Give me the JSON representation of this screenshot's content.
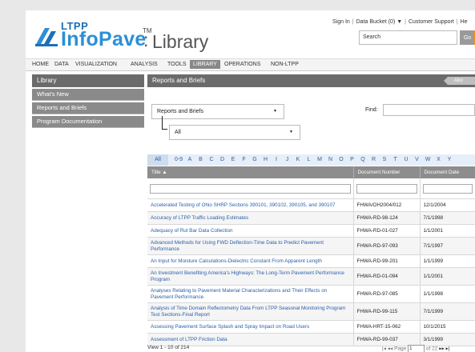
{
  "logo": {
    "ltpp": "LTPP",
    "name": "InfoPave",
    "tm": "TM",
    "separator": ":",
    "section": "Library"
  },
  "toplinks": [
    "Sign In",
    "Data Bucket (0) ▼",
    "Customer Support",
    "He"
  ],
  "search": {
    "placeholder": "Search",
    "go_label": "Go"
  },
  "nav": [
    {
      "label": "HOME",
      "active": false
    },
    {
      "label": "DATA",
      "active": false
    },
    {
      "label": "VISUALIZATION",
      "active": false
    },
    {
      "label": "ANALYSIS",
      "active": false
    },
    {
      "label": "TOOLS",
      "active": false
    },
    {
      "label": "LIBRARY",
      "active": true
    },
    {
      "label": "OPERATIONS",
      "active": false
    },
    {
      "label": "NON-LTPP",
      "active": false
    }
  ],
  "sidebar": {
    "title": "Library",
    "items": [
      "What's New",
      "Reports and Briefs",
      "Program Documentation"
    ]
  },
  "main": {
    "title": "Reports and Briefs",
    "about_label": "Abo",
    "category_select": "Reports and Briefs",
    "sub_select": "All",
    "find_label": "Find:"
  },
  "alphabet": [
    "All",
    "0-9",
    "A",
    "B",
    "C",
    "D",
    "E",
    "F",
    "G",
    "H",
    "I",
    "J",
    "K",
    "L",
    "M",
    "N",
    "O",
    "P",
    "Q",
    "R",
    "S",
    "T",
    "U",
    "V",
    "W",
    "X",
    "Y"
  ],
  "table": {
    "headers": {
      "title": "Title",
      "number": "Document Number",
      "date": "Document Date"
    },
    "sort_icon": "sort-up-icon",
    "rows": [
      {
        "title": "Accelerated Testing of Ohio SHRP Sections 390101, 390102, 390105, and 390107",
        "number": "FHWA/OH2004/012",
        "date": "12/1/2004"
      },
      {
        "title": "Accuracy of LTPP Traffic Loading Estimates",
        "number": "FHWA-RD-98-124",
        "date": "7/1/1998"
      },
      {
        "title": "Adequacy of Rut Bar Data Collection",
        "number": "FHWA-RD-01-027",
        "date": "1/1/2001"
      },
      {
        "title": "Advanced Methods for Using FWD Deflection-Time Data to Predict Pavement Performance",
        "number": "FHWA-RD-97-093",
        "date": "7/1/1997"
      },
      {
        "title": "An Input for Moisture Calculations-Dielectric Constant From Apparent Length",
        "number": "FHWA-RD-99-201",
        "date": "1/1/1999"
      },
      {
        "title": "An Investment Benefiting America's Highways: The Long-Term Pavement Performance Program",
        "number": "FHWA-RD-01-094",
        "date": "1/1/2001"
      },
      {
        "title": "Analyses Relating to Pavement Material Characterizations and Their Effects on Pavement Performance",
        "number": "FHWA-RD-97-085",
        "date": "1/1/1998"
      },
      {
        "title": "Analysis of Time Domain Reflectometry Data From LTPP Seasonal Monitoring Program Test Sections-Final Report",
        "number": "FHWA-RD-99-115",
        "date": "7/1/1999"
      },
      {
        "title": "Assessing Pavement Surface Splash and Spray Impact on Road Users",
        "number": "FHWA-HRT-15-062",
        "date": "10/1/2015"
      },
      {
        "title": "Assessment of LTPP Friction Data",
        "number": "FHWA-RD-99-037",
        "date": "3/1/1999"
      }
    ]
  },
  "footer": {
    "view_text": "View 1 - 10 of 214",
    "page_label": "Page",
    "page_value": "1",
    "of_text": "of 22"
  }
}
